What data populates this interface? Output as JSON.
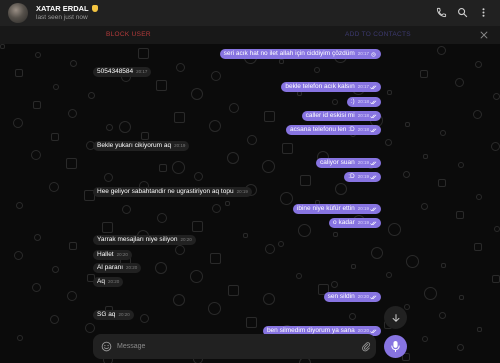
{
  "header": {
    "name": "XATAR ERDAL",
    "status": "last seen just now"
  },
  "action_bar": {
    "block_label": "BLOCK USER",
    "add_contact_label": "ADD TO CONTACTS"
  },
  "messages": [
    {
      "dir": "out",
      "text": "seri acık hat no ilet allah için ciddiyim çözdüm",
      "time": "20:17",
      "status": "clock"
    },
    {
      "dir": "in",
      "text": "5054348584",
      "time": "20:17"
    },
    {
      "dir": "out",
      "text": "bekle telefon acık kalsın",
      "time": "20:17",
      "status": "read"
    },
    {
      "dir": "out",
      "text": ":)",
      "time": "20:18",
      "status": "read"
    },
    {
      "dir": "out",
      "text": "caller id eskisi mi",
      "time": "20:18",
      "status": "read"
    },
    {
      "dir": "out",
      "text": "acsana telefonu len :D",
      "time": "20:18",
      "status": "read"
    },
    {
      "dir": "in",
      "text": "Bekle yukarı cikiyorum aq",
      "time": "20:19"
    },
    {
      "dir": "out",
      "text": "caliyor suan",
      "time": "20:19",
      "status": "read"
    },
    {
      "dir": "out",
      "text": ":D",
      "time": "20:19",
      "status": "read"
    },
    {
      "dir": "in",
      "text": "Hee geliyor sabahtandir ne ugrastiriyon aq topu",
      "time": "20:19"
    },
    {
      "dir": "out",
      "text": "ibine niye küfür ettin",
      "time": "20:19",
      "status": "read"
    },
    {
      "dir": "out",
      "text": "o kadar",
      "time": "20:19",
      "status": "read"
    },
    {
      "dir": "in",
      "text": "Yarrak mesajları niye siliyon",
      "time": "20:20"
    },
    {
      "dir": "in",
      "text": "Hallet",
      "time": "20:20"
    },
    {
      "dir": "in",
      "text": "Al paranı",
      "time": "20:20"
    },
    {
      "dir": "in",
      "text": "Aq",
      "time": "20:20"
    },
    {
      "dir": "out",
      "text": "sen sildin",
      "time": "20:20",
      "status": "read"
    },
    {
      "dir": "in",
      "text": "SG aq",
      "time": "20:20"
    },
    {
      "dir": "out",
      "text": "ben silmedim diyorum ya sana",
      "time": "20:20",
      "status": "read"
    }
  ],
  "composer": {
    "placeholder": "Message"
  },
  "icons": {
    "phone": "phone-icon",
    "search": "search-icon",
    "more": "more-vertical-icon",
    "close": "close-icon",
    "emoji": "smile-icon",
    "attach": "paperclip-icon",
    "mic": "microphone-icon",
    "scroll_down": "arrow-down-icon"
  },
  "colors": {
    "accent": "#8774e1",
    "block": "#b33a3a",
    "incoming": "#212121",
    "background": "#0b0b0b"
  }
}
